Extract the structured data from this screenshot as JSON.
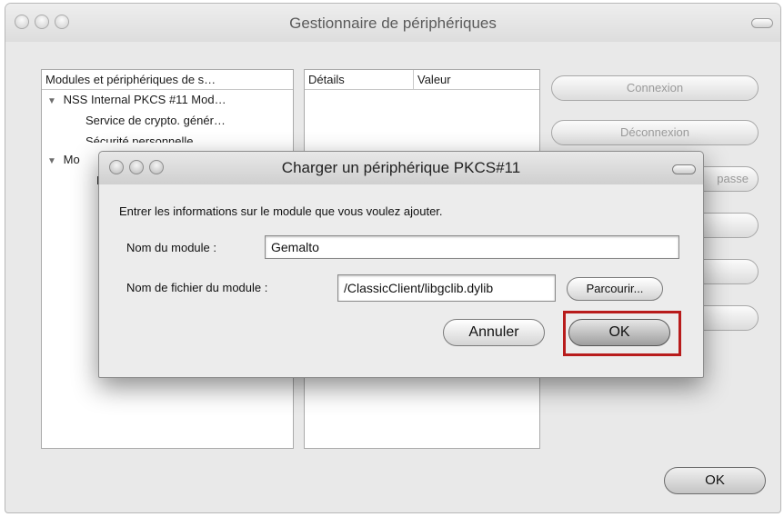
{
  "main_window": {
    "title": "Gestionnaire de périphériques",
    "modules_header": "Modules et périphériques de s…",
    "tree": [
      {
        "label": "NSS Internal PKCS #11 Mod…",
        "expanded": true
      },
      {
        "label": "Service de crypto. génér…"
      },
      {
        "label": "Sécurité personnelle"
      },
      {
        "label": "Mo",
        "expanded": true
      },
      {
        "label": "P"
      }
    ],
    "details_header": "Détails",
    "value_header": "Valeur",
    "buttons": {
      "connexion": "Connexion",
      "deconnexion": "Déconnexion",
      "password_partial": "passe"
    },
    "ok_label": "OK"
  },
  "dialog": {
    "title": "Charger un périphérique PKCS#11",
    "instruction": "Entrer les informations sur le module que vous voulez ajouter.",
    "module_name_label": "Nom du module :",
    "module_name_value": "Gemalto",
    "module_file_label": "Nom de fichier du module :",
    "module_file_value": "/ClassicClient/libgclib.dylib",
    "browse_label": "Parcourir...",
    "cancel_label": "Annuler",
    "ok_label": "OK"
  },
  "colors": {
    "highlight": "#b81c1c"
  }
}
